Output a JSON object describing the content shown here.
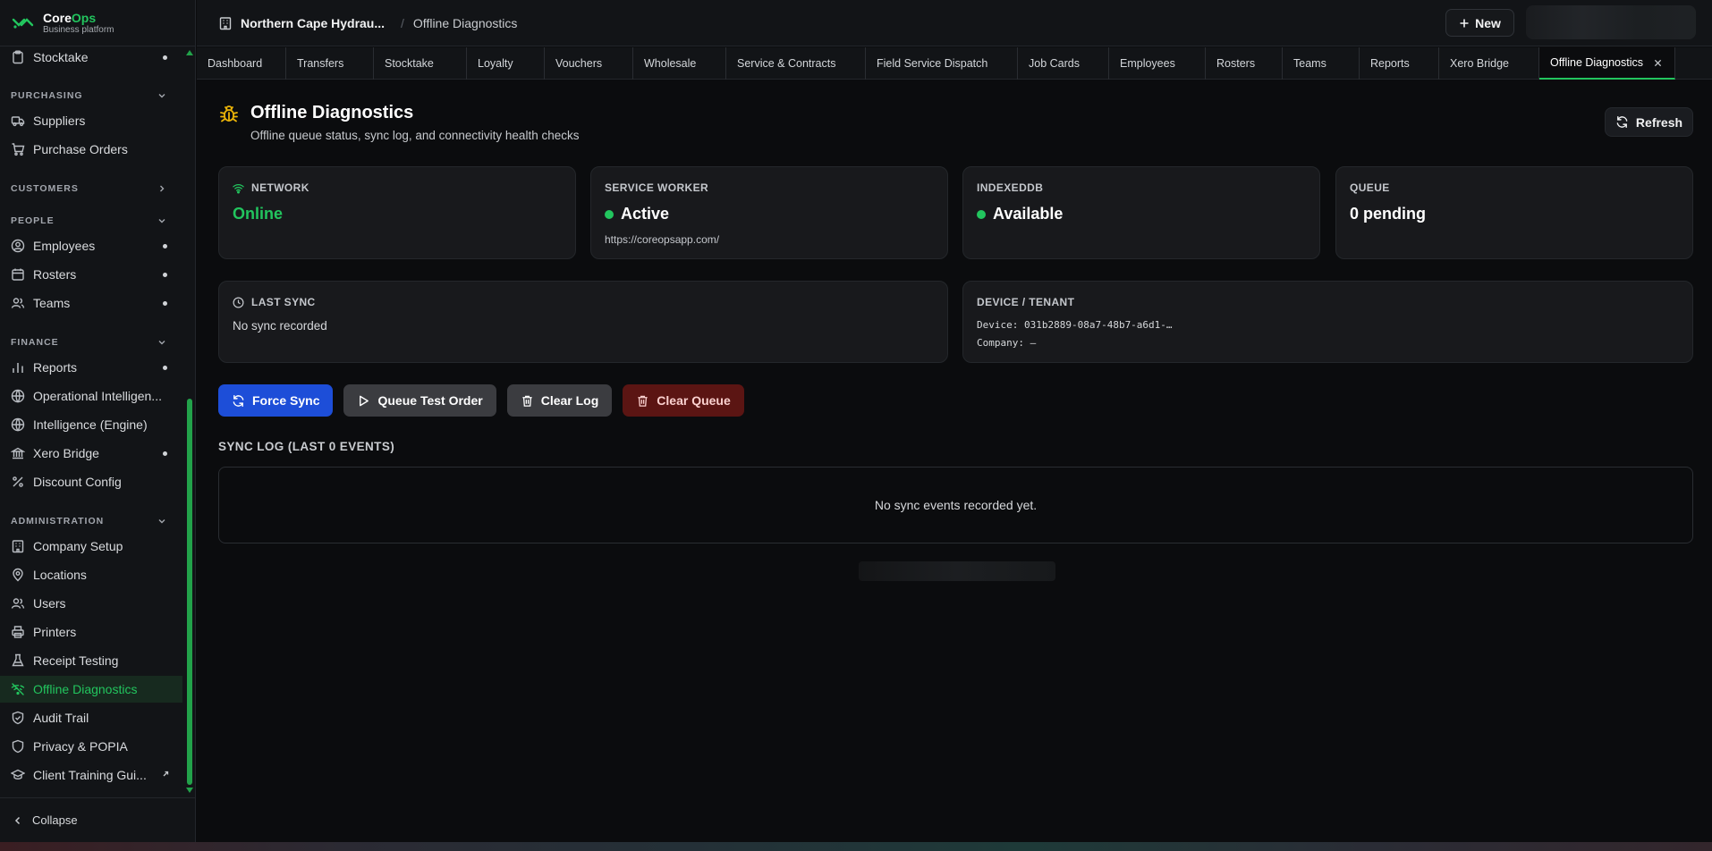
{
  "brand": {
    "name_a": "Core",
    "name_b": "Ops",
    "subtitle": "Business platform"
  },
  "colors": {
    "accent": "#22c55e",
    "primary_button": "#1d4ed8",
    "danger_button": "#5b1513",
    "warning_icon": "#eab308"
  },
  "sidebar": {
    "top_item": {
      "label": "Stocktake",
      "icon": "clipboard-icon"
    },
    "sections": [
      {
        "title": "PURCHASING",
        "expanded": true,
        "items": [
          {
            "label": "Suppliers",
            "icon": "truck-icon"
          },
          {
            "label": "Purchase Orders",
            "icon": "cart-icon"
          }
        ]
      },
      {
        "title": "CUSTOMERS",
        "expanded": false,
        "items": []
      },
      {
        "title": "PEOPLE",
        "expanded": true,
        "items": [
          {
            "label": "Employees",
            "icon": "user-circle-icon"
          },
          {
            "label": "Rosters",
            "icon": "calendar-icon"
          },
          {
            "label": "Teams",
            "icon": "users-icon"
          }
        ]
      },
      {
        "title": "FINANCE",
        "expanded": true,
        "items": [
          {
            "label": "Reports",
            "icon": "bar-chart-icon"
          },
          {
            "label": "Operational Intelligen...",
            "icon": "globe-icon"
          },
          {
            "label": "Intelligence (Engine)",
            "icon": "globe-icon"
          },
          {
            "label": "Xero Bridge",
            "icon": "bank-icon"
          },
          {
            "label": "Discount Config",
            "icon": "percent-icon"
          }
        ]
      },
      {
        "title": "ADMINISTRATION",
        "expanded": true,
        "items": [
          {
            "label": "Company Setup",
            "icon": "building-icon"
          },
          {
            "label": "Locations",
            "icon": "map-pin-icon"
          },
          {
            "label": "Users",
            "icon": "users-icon"
          },
          {
            "label": "Printers",
            "icon": "printer-icon"
          },
          {
            "label": "Receipt Testing",
            "icon": "flask-icon"
          },
          {
            "label": "Offline Diagnostics",
            "icon": "wifi-off-icon",
            "active": true
          },
          {
            "label": "Audit Trail",
            "icon": "shield-icon"
          },
          {
            "label": "Privacy & POPIA",
            "icon": "shield-icon"
          },
          {
            "label": "Client Training Gui...",
            "icon": "graduation-cap-icon"
          }
        ]
      }
    ],
    "collapse_label": "Collapse"
  },
  "header": {
    "org_name": "Northern Cape Hydrau...",
    "breadcrumb": "Offline Diagnostics",
    "new_label": "New"
  },
  "tabs": [
    {
      "label": "Dashboard"
    },
    {
      "label": "Transfers"
    },
    {
      "label": "Stocktake"
    },
    {
      "label": "Loyalty"
    },
    {
      "label": "Vouchers"
    },
    {
      "label": "Wholesale"
    },
    {
      "label": "Service & Contracts"
    },
    {
      "label": "Field Service Dispatch"
    },
    {
      "label": "Job Cards"
    },
    {
      "label": "Employees"
    },
    {
      "label": "Rosters"
    },
    {
      "label": "Teams"
    },
    {
      "label": "Reports"
    },
    {
      "label": "Xero Bridge"
    },
    {
      "label": "Offline Diagnostics",
      "active": true
    }
  ],
  "page": {
    "title": "Offline Diagnostics",
    "subtitle": "Offline queue status, sync log, and connectivity health checks",
    "refresh_label": "Refresh"
  },
  "cards": {
    "network": {
      "label": "NETWORK",
      "value": "Online"
    },
    "service_worker": {
      "label": "SERVICE WORKER",
      "value": "Active",
      "note": "https://coreopsapp.com/"
    },
    "indexeddb": {
      "label": "INDEXEDDB",
      "value": "Available"
    },
    "queue": {
      "label": "QUEUE",
      "value": "0 pending"
    },
    "last_sync": {
      "label": "LAST SYNC",
      "value": "No sync recorded"
    },
    "device": {
      "label": "DEVICE / TENANT",
      "device_line": "Device: 031b2889-08a7-48b7-a6d1-…",
      "company_line": "Company: —"
    }
  },
  "actions": {
    "force_sync": "Force Sync",
    "queue_test_order": "Queue Test Order",
    "clear_log": "Clear Log",
    "clear_queue": "Clear Queue"
  },
  "sync_log": {
    "title": "SYNC LOG (LAST 0 EVENTS)",
    "empty_text": "No sync events recorded yet."
  }
}
